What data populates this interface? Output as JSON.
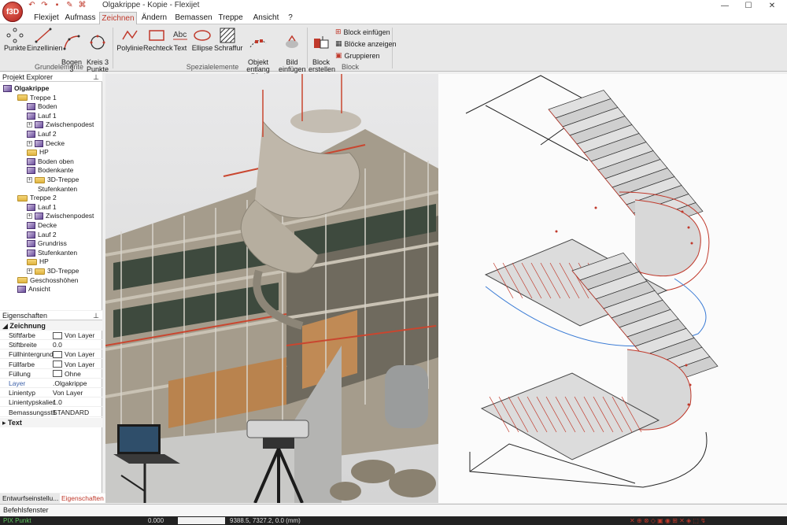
{
  "app": {
    "logo_text": "f3D",
    "title": "Olgakrippe - Kopie - Flexijet"
  },
  "colors": {
    "accent": "#c0392b",
    "ribbon_bg": "#e8e8e8",
    "stair_red": "#c0392b",
    "stair_blue": "#3a7bd5"
  },
  "tabs": [
    {
      "label": "Flexijet"
    },
    {
      "label": "Aufmass"
    },
    {
      "label": "Zeichnen",
      "active": true
    },
    {
      "label": "Ändern"
    },
    {
      "label": "Bemassen"
    },
    {
      "label": "Treppe"
    },
    {
      "label": "Ansicht"
    },
    {
      "label": "?"
    }
  ],
  "ribbon": {
    "buttons": [
      {
        "label": "Punkte",
        "icon": "points-icon"
      },
      {
        "label": "Einzellinien",
        "icon": "line-icon"
      },
      {
        "label": "Bogen 3\nPunkte",
        "icon": "arc-icon"
      },
      {
        "label": "Kreis 3\nPunkte",
        "icon": "circle-icon"
      },
      {
        "label": "Polylinie",
        "icon": "polyline-icon"
      },
      {
        "label": "Rechteck",
        "icon": "rectangle-icon"
      },
      {
        "label": "Text",
        "icon": "text-icon"
      },
      {
        "label": "Ellipse",
        "icon": "ellipse-icon"
      },
      {
        "label": "Schraffur",
        "icon": "hatch-icon"
      },
      {
        "label": "Objekt\nentlang Pfad",
        "icon": "path-object-icon"
      },
      {
        "label": "Bild\neinfügen",
        "icon": "image-insert-icon"
      },
      {
        "label": "Block\nerstellen",
        "icon": "block-create-icon"
      }
    ],
    "block_items": [
      {
        "label": "Block einfügen"
      },
      {
        "label": "Blöcke anzeigen"
      },
      {
        "label": "Gruppieren"
      }
    ],
    "groups": {
      "grund": "Grundelemente",
      "spezial": "Spezialelemente",
      "block": "Block"
    }
  },
  "explorer": {
    "title": "Projekt Explorer",
    "items": [
      {
        "label": "Olgakrippe",
        "level": 0,
        "icon": "project",
        "bold": true
      },
      {
        "label": "Treppe 1",
        "level": 1,
        "icon": "folder"
      },
      {
        "label": "Boden",
        "level": 2,
        "icon": "cube"
      },
      {
        "label": "Lauf 1",
        "level": 2,
        "icon": "cube"
      },
      {
        "label": "Zwischenpodest",
        "level": 2,
        "icon": "cube",
        "expand": true
      },
      {
        "label": "Lauf 2",
        "level": 2,
        "icon": "cube"
      },
      {
        "label": "Decke",
        "level": 2,
        "icon": "cube",
        "expand": true
      },
      {
        "label": "HP",
        "level": 2,
        "icon": "folder"
      },
      {
        "label": "Boden oben",
        "level": 2,
        "icon": "cube"
      },
      {
        "label": "Bodenkante",
        "level": 2,
        "icon": "cube"
      },
      {
        "label": "3D-Treppe",
        "level": 2,
        "icon": "folder",
        "expand": true
      },
      {
        "label": "Stufenkanten",
        "level": 2,
        "icon": "none"
      },
      {
        "label": "Treppe 2",
        "level": 1,
        "icon": "folder"
      },
      {
        "label": "Lauf 1",
        "level": 2,
        "icon": "cube"
      },
      {
        "label": "Zwischenpodest",
        "level": 2,
        "icon": "cube",
        "expand": true
      },
      {
        "label": "Decke",
        "level": 2,
        "icon": "cube"
      },
      {
        "label": "Lauf 2",
        "level": 2,
        "icon": "cube"
      },
      {
        "label": "Grundriss",
        "level": 2,
        "icon": "cube"
      },
      {
        "label": "Stufenkanten",
        "level": 2,
        "icon": "cube"
      },
      {
        "label": "HP",
        "level": 2,
        "icon": "folder"
      },
      {
        "label": "3D-Treppe",
        "level": 2,
        "icon": "folder",
        "expand": true
      },
      {
        "label": "Geschosshöhen",
        "level": 1,
        "icon": "folder"
      },
      {
        "label": "Ansicht",
        "level": 1,
        "icon": "cube"
      }
    ]
  },
  "properties": {
    "title": "Eigenschaften",
    "category": "Zeichnung",
    "rows": [
      {
        "key": "Stiftfarbe",
        "value": "Von Layer",
        "swatch": true
      },
      {
        "key": "Stiftbreite",
        "value": "0.0"
      },
      {
        "key": "Füllhintergrund",
        "value": "Von Layer",
        "swatch": true
      },
      {
        "key": "Füllfarbe",
        "value": "Von Layer",
        "swatch": true
      },
      {
        "key": "Füllung",
        "value": "Ohne",
        "swatch": true
      },
      {
        "key": "Layer",
        "value": ".Olgakrippe",
        "highlight": true
      },
      {
        "key": "Linientyp",
        "value": "Von Layer"
      },
      {
        "key": "Linientypskalier",
        "value": "1.0"
      },
      {
        "key": "Bemassungsstil",
        "value": "STANDARD"
      }
    ],
    "category2": "Text"
  },
  "bottom_tabs": {
    "tab1": "Entwurfseinstellu...",
    "tab2": "Eigenschaften"
  },
  "command_window": "Befehlsfenster",
  "status": {
    "mode": "PIX Punkt",
    "value1": "0.000",
    "coords": "9388.5, 7327.2, 0.0 (mm)"
  }
}
